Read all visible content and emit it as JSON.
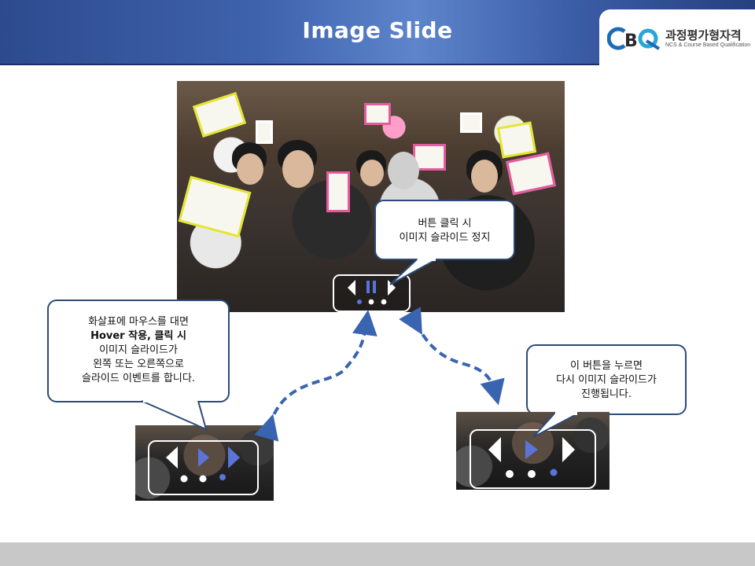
{
  "header": {
    "title": "Image Slide",
    "logo": {
      "mark": "CBQ",
      "name_ko": "과정평가형자격",
      "subtitle": "NCS & Course Based Qualification",
      "colors": {
        "c": "#1a6cb5",
        "b": "#2a2a2a",
        "q": "#2aa5d8"
      }
    }
  },
  "main_slide": {
    "controls": {
      "prev": "prev-arrow-icon",
      "pause": "pause-icon",
      "next": "next-arrow-icon",
      "dots": 3,
      "active_dot": 1
    }
  },
  "callouts": {
    "pause": {
      "lines": [
        "버튼 클릭 시",
        "이미지 슬라이드 정지"
      ]
    },
    "arrows": {
      "lines": [
        "화살표에 마우스를 대면",
        "Hover 작용, 클릭 시",
        "이미지 슬라이드가",
        "왼쪽 또는 오른쪽으로",
        "슬라이드 이벤트를 합니다."
      ]
    },
    "play": {
      "lines": [
        "이 버튼을 누르면",
        "다시 이미지 슬라이드가",
        "진행됩니다."
      ]
    }
  },
  "thumbnails": [
    {
      "name": "hover-example",
      "dots": 3,
      "active_dot": 3
    },
    {
      "name": "play-example",
      "dots": 3,
      "active_dot": 3
    }
  ],
  "colors": {
    "accent": "#4a6fb5",
    "arrow_blue": "#3a64b0",
    "callout_border": "#2c4a78",
    "active_icon": "#5b74d8"
  }
}
